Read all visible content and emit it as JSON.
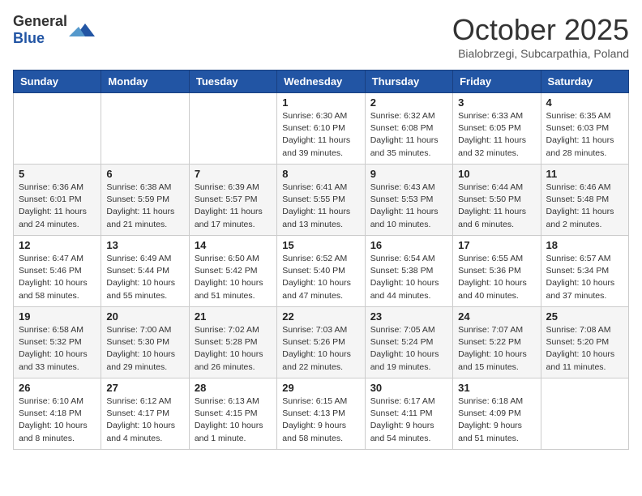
{
  "logo": {
    "general": "General",
    "blue": "Blue"
  },
  "title": "October 2025",
  "subtitle": "Bialobrzegi, Subcarpathia, Poland",
  "days_of_week": [
    "Sunday",
    "Monday",
    "Tuesday",
    "Wednesday",
    "Thursday",
    "Friday",
    "Saturday"
  ],
  "weeks": [
    [
      {
        "day": "",
        "info": ""
      },
      {
        "day": "",
        "info": ""
      },
      {
        "day": "",
        "info": ""
      },
      {
        "day": "1",
        "info": "Sunrise: 6:30 AM\nSunset: 6:10 PM\nDaylight: 11 hours\nand 39 minutes."
      },
      {
        "day": "2",
        "info": "Sunrise: 6:32 AM\nSunset: 6:08 PM\nDaylight: 11 hours\nand 35 minutes."
      },
      {
        "day": "3",
        "info": "Sunrise: 6:33 AM\nSunset: 6:05 PM\nDaylight: 11 hours\nand 32 minutes."
      },
      {
        "day": "4",
        "info": "Sunrise: 6:35 AM\nSunset: 6:03 PM\nDaylight: 11 hours\nand 28 minutes."
      }
    ],
    [
      {
        "day": "5",
        "info": "Sunrise: 6:36 AM\nSunset: 6:01 PM\nDaylight: 11 hours\nand 24 minutes."
      },
      {
        "day": "6",
        "info": "Sunrise: 6:38 AM\nSunset: 5:59 PM\nDaylight: 11 hours\nand 21 minutes."
      },
      {
        "day": "7",
        "info": "Sunrise: 6:39 AM\nSunset: 5:57 PM\nDaylight: 11 hours\nand 17 minutes."
      },
      {
        "day": "8",
        "info": "Sunrise: 6:41 AM\nSunset: 5:55 PM\nDaylight: 11 hours\nand 13 minutes."
      },
      {
        "day": "9",
        "info": "Sunrise: 6:43 AM\nSunset: 5:53 PM\nDaylight: 11 hours\nand 10 minutes."
      },
      {
        "day": "10",
        "info": "Sunrise: 6:44 AM\nSunset: 5:50 PM\nDaylight: 11 hours\nand 6 minutes."
      },
      {
        "day": "11",
        "info": "Sunrise: 6:46 AM\nSunset: 5:48 PM\nDaylight: 11 hours\nand 2 minutes."
      }
    ],
    [
      {
        "day": "12",
        "info": "Sunrise: 6:47 AM\nSunset: 5:46 PM\nDaylight: 10 hours\nand 58 minutes."
      },
      {
        "day": "13",
        "info": "Sunrise: 6:49 AM\nSunset: 5:44 PM\nDaylight: 10 hours\nand 55 minutes."
      },
      {
        "day": "14",
        "info": "Sunrise: 6:50 AM\nSunset: 5:42 PM\nDaylight: 10 hours\nand 51 minutes."
      },
      {
        "day": "15",
        "info": "Sunrise: 6:52 AM\nSunset: 5:40 PM\nDaylight: 10 hours\nand 47 minutes."
      },
      {
        "day": "16",
        "info": "Sunrise: 6:54 AM\nSunset: 5:38 PM\nDaylight: 10 hours\nand 44 minutes."
      },
      {
        "day": "17",
        "info": "Sunrise: 6:55 AM\nSunset: 5:36 PM\nDaylight: 10 hours\nand 40 minutes."
      },
      {
        "day": "18",
        "info": "Sunrise: 6:57 AM\nSunset: 5:34 PM\nDaylight: 10 hours\nand 37 minutes."
      }
    ],
    [
      {
        "day": "19",
        "info": "Sunrise: 6:58 AM\nSunset: 5:32 PM\nDaylight: 10 hours\nand 33 minutes."
      },
      {
        "day": "20",
        "info": "Sunrise: 7:00 AM\nSunset: 5:30 PM\nDaylight: 10 hours\nand 29 minutes."
      },
      {
        "day": "21",
        "info": "Sunrise: 7:02 AM\nSunset: 5:28 PM\nDaylight: 10 hours\nand 26 minutes."
      },
      {
        "day": "22",
        "info": "Sunrise: 7:03 AM\nSunset: 5:26 PM\nDaylight: 10 hours\nand 22 minutes."
      },
      {
        "day": "23",
        "info": "Sunrise: 7:05 AM\nSunset: 5:24 PM\nDaylight: 10 hours\nand 19 minutes."
      },
      {
        "day": "24",
        "info": "Sunrise: 7:07 AM\nSunset: 5:22 PM\nDaylight: 10 hours\nand 15 minutes."
      },
      {
        "day": "25",
        "info": "Sunrise: 7:08 AM\nSunset: 5:20 PM\nDaylight: 10 hours\nand 11 minutes."
      }
    ],
    [
      {
        "day": "26",
        "info": "Sunrise: 6:10 AM\nSunset: 4:18 PM\nDaylight: 10 hours\nand 8 minutes."
      },
      {
        "day": "27",
        "info": "Sunrise: 6:12 AM\nSunset: 4:17 PM\nDaylight: 10 hours\nand 4 minutes."
      },
      {
        "day": "28",
        "info": "Sunrise: 6:13 AM\nSunset: 4:15 PM\nDaylight: 10 hours\nand 1 minute."
      },
      {
        "day": "29",
        "info": "Sunrise: 6:15 AM\nSunset: 4:13 PM\nDaylight: 9 hours\nand 58 minutes."
      },
      {
        "day": "30",
        "info": "Sunrise: 6:17 AM\nSunset: 4:11 PM\nDaylight: 9 hours\nand 54 minutes."
      },
      {
        "day": "31",
        "info": "Sunrise: 6:18 AM\nSunset: 4:09 PM\nDaylight: 9 hours\nand 51 minutes."
      },
      {
        "day": "",
        "info": ""
      }
    ]
  ]
}
